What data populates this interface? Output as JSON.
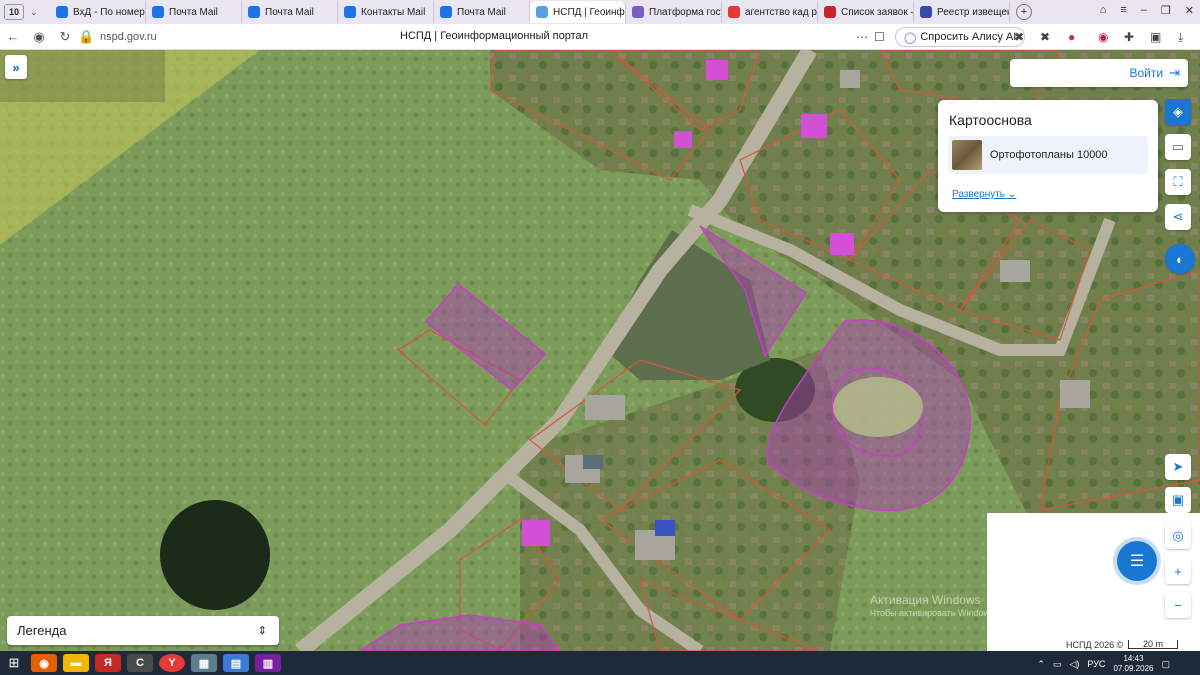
{
  "browser": {
    "tab_count": "10",
    "tabs": [
      {
        "label": "ВхД - По номеру",
        "color": "#1a73e8"
      },
      {
        "label": "Почта Mail",
        "color": "#1a73e8"
      },
      {
        "label": "Почта Mail",
        "color": "#1a73e8"
      },
      {
        "label": "Контакты Mail",
        "color": "#1a73e8"
      },
      {
        "label": "Почта Mail",
        "color": "#1a73e8"
      },
      {
        "label": "НСПД | Геоинф",
        "color": "#5aa0e0",
        "active": true
      },
      {
        "label": "Платформа госуд",
        "color": "#7a5cc7"
      },
      {
        "label": "агентство кад раб",
        "color": "#e53935"
      },
      {
        "label": "Список заявок —",
        "color": "#c62828"
      },
      {
        "label": "Реестр извещени",
        "color": "#3949ab"
      }
    ],
    "url": "nspd.gov.ru",
    "page_title": "НСПД | Геоинформационный портал",
    "alice_label": "Спросить Алису AI"
  },
  "map": {
    "login_label": "Войти",
    "basemap": {
      "title": "Картооснова",
      "layer": "Ортофотопланы 10000",
      "expand_label": "Развернуть"
    },
    "legend_label": "Легенда",
    "attribution": "НСПД 2026 ©",
    "scale_label": "20 m",
    "watermark_title": "Активация Windows",
    "watermark_text": "Чтобы активировать Windows, перейдите в раздел \"Параметры\"."
  },
  "taskbar": {
    "lang": "РУС",
    "time": "14:43",
    "date": "07.09.2026"
  },
  "colors": {
    "accent": "#1976d2",
    "parcel_magenta": "#c83ec8",
    "parcel_red": "#d9553a"
  }
}
